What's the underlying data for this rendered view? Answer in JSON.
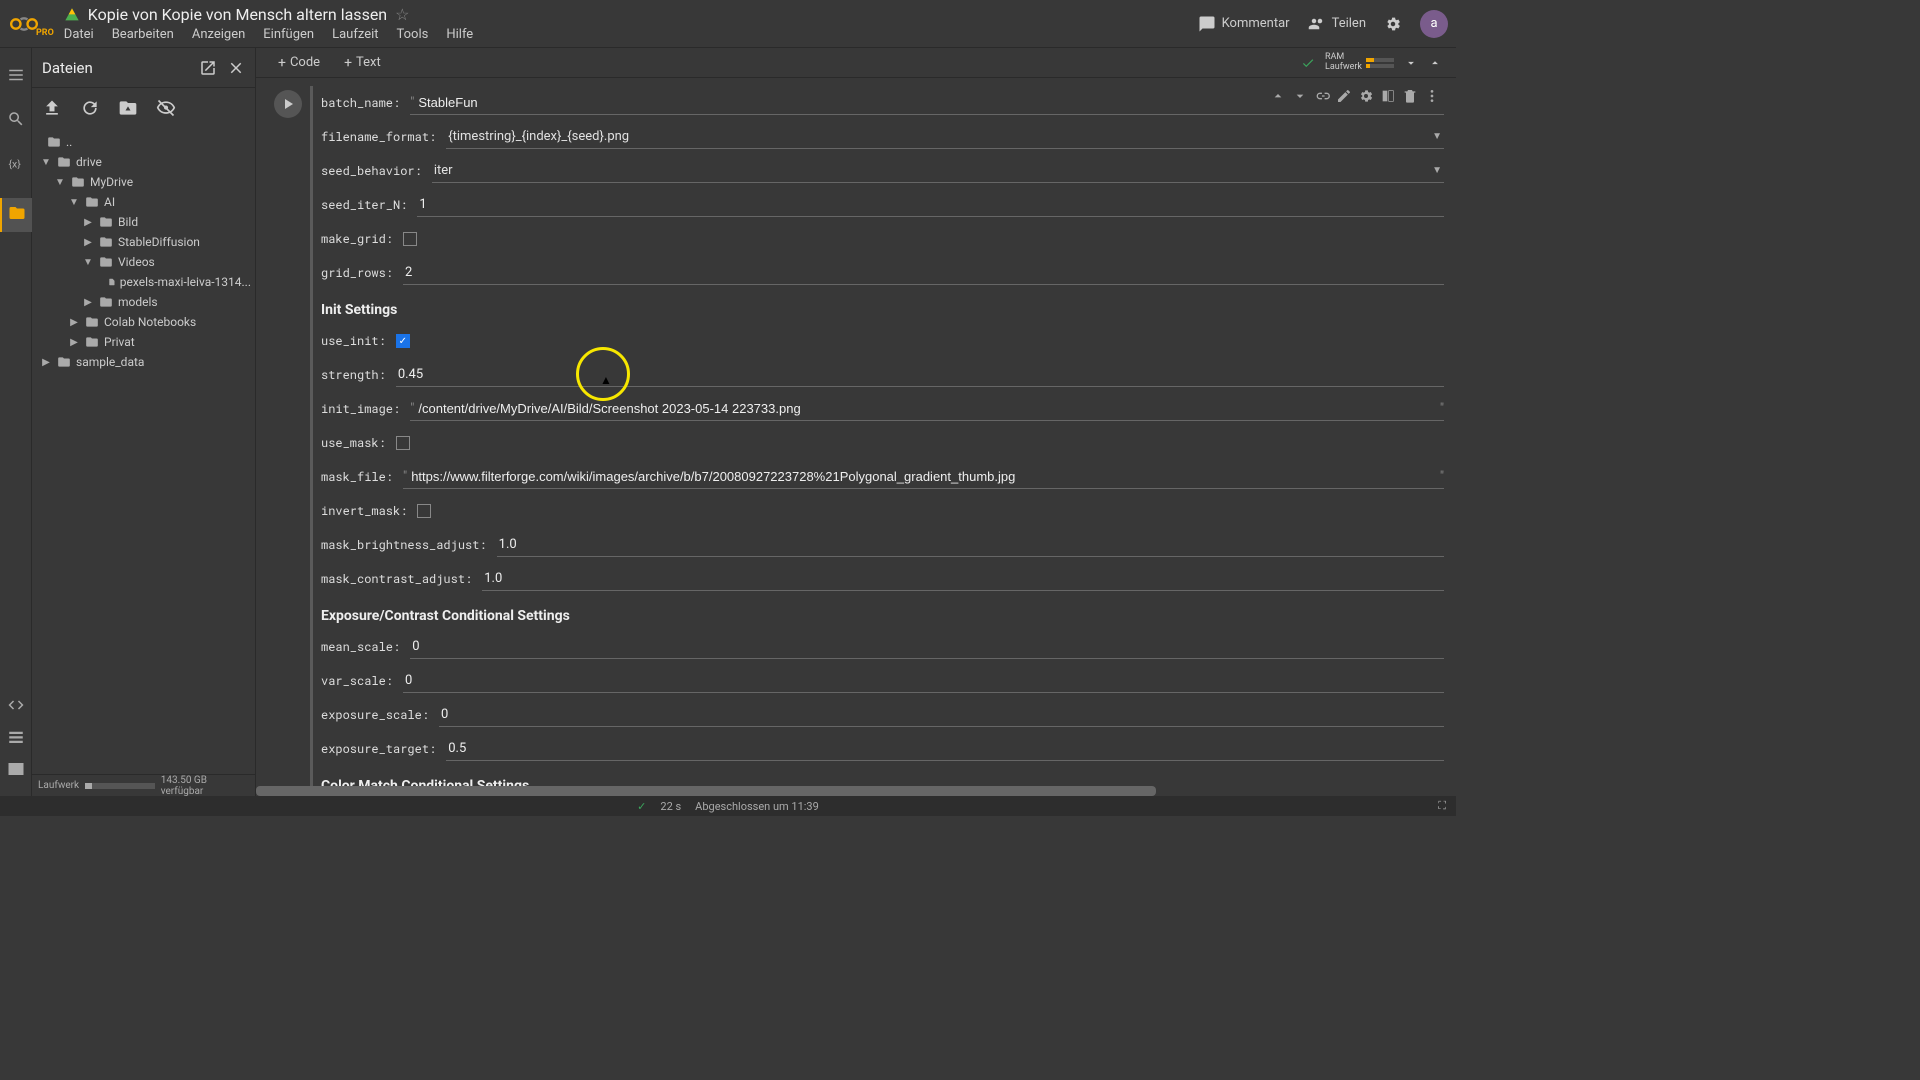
{
  "header": {
    "pro": "PRO",
    "title": "Kopie von Kopie von Mensch altern lassen",
    "menus": [
      "Datei",
      "Bearbeiten",
      "Anzeigen",
      "Einfügen",
      "Laufzeit",
      "Tools",
      "Hilfe"
    ],
    "comment": "Kommentar",
    "share": "Teilen",
    "avatar": "a",
    "ram": "RAM",
    "disk": "Laufwerk"
  },
  "filepanel": {
    "title": "Dateien",
    "tree": {
      "parent": "..",
      "drive": "drive",
      "mydrive": "MyDrive",
      "ai": "AI",
      "bild": "Bild",
      "stablediffusion": "StableDiffusion",
      "videos": "Videos",
      "pexels": "pexels-maxi-leiva-1314...",
      "models": "models",
      "colab": "Colab Notebooks",
      "privat": "Privat",
      "sample": "sample_data"
    },
    "footer_label": "Laufwerk",
    "footer_disk": "143.50 GB verfügbar"
  },
  "toolbar": {
    "code": "Code",
    "text": "Text"
  },
  "form": {
    "batch_name_label": "batch_name:",
    "batch_name": "StableFun",
    "filename_format_label": "filename_format:",
    "filename_format": "{timestring}_{index}_{seed}.png",
    "seed_behavior_label": "seed_behavior:",
    "seed_behavior": "iter",
    "seed_iter_n_label": "seed_iter_N:",
    "seed_iter_n": "1",
    "make_grid_label": "make_grid:",
    "grid_rows_label": "grid_rows:",
    "grid_rows": "2",
    "init_header": "Init Settings",
    "use_init_label": "use_init:",
    "strength_label": "strength:",
    "strength": "0.45",
    "init_image_label": "init_image:",
    "init_image": "/content/drive/MyDrive/AI/Bild/Screenshot 2023-05-14 223733.png",
    "use_mask_label": "use_mask:",
    "mask_file_label": "mask_file:",
    "mask_file": "https://www.filterforge.com/wiki/images/archive/b/b7/20080927223728%21Polygonal_gradient_thumb.jpg",
    "invert_mask_label": "invert_mask:",
    "mask_brightness_label": "mask_brightness_adjust:",
    "mask_brightness": "1.0",
    "mask_contrast_label": "mask_contrast_adjust:",
    "mask_contrast": "1.0",
    "exposure_header": "Exposure/Contrast Conditional Settings",
    "mean_scale_label": "mean_scale:",
    "mean_scale": "0",
    "var_scale_label": "var_scale:",
    "var_scale": "0",
    "exposure_scale_label": "exposure_scale:",
    "exposure_scale": "0",
    "exposure_target_label": "exposure_target:",
    "exposure_target": "0.5",
    "color_header": "Color Match Conditional Settings"
  },
  "footer": {
    "duration": "22 s",
    "completed": "Abgeschlossen um 11:39"
  }
}
